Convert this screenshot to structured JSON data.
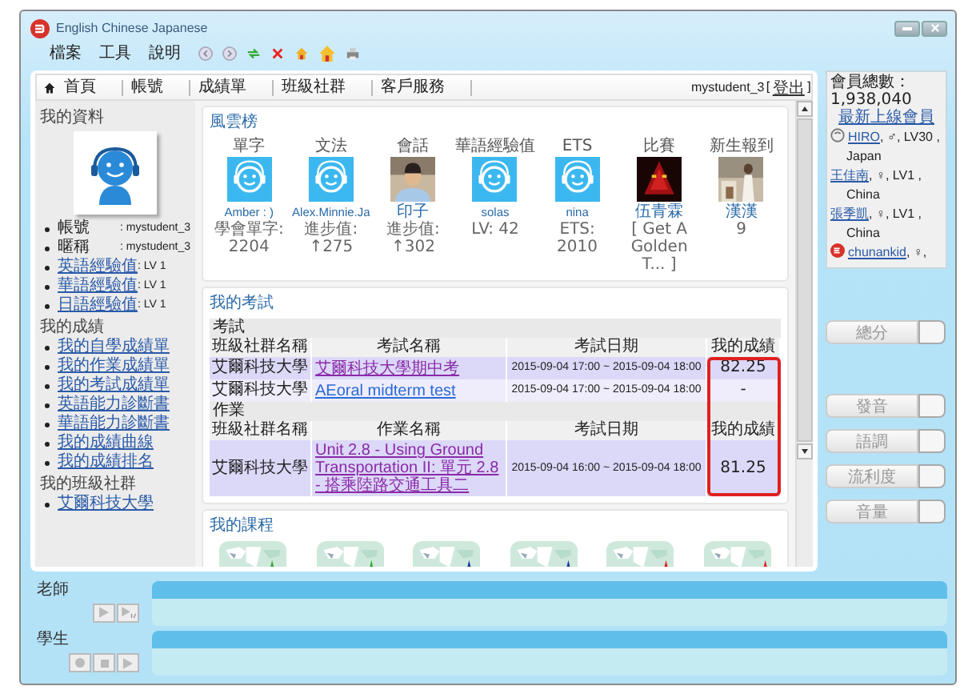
{
  "window": {
    "title": "English Chinese Japanese"
  },
  "menu": [
    "檔案",
    "工具",
    "說明"
  ],
  "nav": {
    "tabs": [
      {
        "label": "首頁",
        "kind": "home"
      },
      {
        "label": "帳號",
        "kind": "plain"
      },
      {
        "label": "成績單",
        "kind": "plain"
      },
      {
        "label": "班級社群",
        "kind": "plain"
      },
      {
        "label": "客戶服務",
        "kind": "plain"
      }
    ],
    "user": "mystudent_3",
    "brackets": [
      "[",
      "]"
    ],
    "logout": "登出"
  },
  "profile": {
    "title": "我的資料",
    "fields": [
      {
        "label": "帳號",
        "value": ": mystudent_3",
        "kind": "text"
      },
      {
        "label": "暱稱",
        "value": ": mystudent_3",
        "kind": "text"
      },
      {
        "label": "英語經驗值",
        "value": ": LV 1",
        "kind": "link"
      },
      {
        "label": "華語經驗值",
        "value": ": LV 1",
        "kind": "link"
      },
      {
        "label": "日語經驗值",
        "value": ": LV 1",
        "kind": "link"
      }
    ]
  },
  "grades": {
    "title": "我的成績",
    "links": [
      "我的自學成績單",
      "我的作業成績單",
      "我的考試成績單",
      "英語能力診斷書",
      "華語能力診斷書",
      "我的成績曲線",
      "我的成績排名"
    ]
  },
  "groups": {
    "title": "我的班級社群",
    "links": [
      "艾爾科技大學"
    ]
  },
  "leaderboard": {
    "title": "風雲榜",
    "entries": [
      {
        "category": "單字",
        "name": "Amber : )",
        "stat": "學會單字: 2204",
        "kind": "icon"
      },
      {
        "category": "文法",
        "name": "Alex.Minnie.Ja",
        "stat": "進步值: ↑275",
        "kind": "icon"
      },
      {
        "category": "會話",
        "name": "印子",
        "stat": "進步值: ↑302",
        "kind": "picture"
      },
      {
        "category": "華語經驗值",
        "name": "solas",
        "stat": "LV: 42",
        "kind": "icon"
      },
      {
        "category": "ETS",
        "name": "nina",
        "stat": "ETS: 2010",
        "kind": "icon"
      },
      {
        "category": "比賽",
        "name": "伍青霖",
        "stat": "[ Get A Golden T... ]",
        "kind": "picture"
      },
      {
        "category": "新生報到",
        "name": "漢漢",
        "stat": "9",
        "kind": "picture"
      }
    ]
  },
  "exams": {
    "title": "我的考試",
    "score_frame": true,
    "sections": [
      {
        "label": "考試",
        "columns": [
          "班級社群名稱",
          "考試名稱",
          "考試日期",
          "我的成績"
        ],
        "rows": [
          {
            "group": "艾爾科技大學",
            "name": "艾爾科技大學期中考",
            "visited": true,
            "date": "2015-09-04 17:00 ~ 2015-09-04 18:00",
            "score": "82.25"
          },
          {
            "group": "艾爾科技大學",
            "name": "AEoral midterm test",
            "visited": false,
            "date": "2015-09-04 17:00 ~ 2015-09-04 18:00",
            "score": "-"
          }
        ]
      },
      {
        "label": "作業",
        "columns": [
          "班級社群名稱",
          "作業名稱",
          "考試日期",
          "我的成績"
        ],
        "rows": [
          {
            "group": "艾爾科技大學",
            "name": "Unit 2.8 - Using Ground Transportation II: 單元 2.8 - 搭乘陸路交通工具二",
            "visited": true,
            "date": "2015-09-04 16:00 ~ 2015-09-04 18:00",
            "score": "81.25"
          }
        ]
      }
    ]
  },
  "courses": {
    "title": "我的課程"
  },
  "members": {
    "total": "會員總數：1,938,040",
    "latest": "最新上線會員",
    "list": [
      {
        "name": "HIRO",
        "details": ", ♂, LV30 ,",
        "country": "Japan",
        "kind": "avatar"
      },
      {
        "name": "王佳南",
        "details": ", ♀, LV1 ,",
        "country": "China",
        "kind": "plain"
      },
      {
        "name": "張季凱",
        "details": ", ♀, LV1 ,",
        "country": "China",
        "kind": "plain"
      },
      {
        "name": "chunankid",
        "details": ", ♀,",
        "kind": "logo"
      }
    ]
  },
  "scores": [
    {
      "label": "總分",
      "disabled": true
    },
    {
      "label": "發音",
      "disabled": true
    },
    {
      "label": "語調",
      "disabled": true
    },
    {
      "label": "流利度",
      "disabled": true
    },
    {
      "label": "音量",
      "disabled": true
    }
  ],
  "tracks": [
    {
      "label": "老師",
      "controls": [
        {
          "kind": "play"
        },
        {
          "kind": "halfplay"
        }
      ]
    },
    {
      "label": "學生",
      "controls": [
        {
          "kind": "record"
        },
        {
          "kind": "stop"
        },
        {
          "kind": "play"
        }
      ]
    }
  ]
}
